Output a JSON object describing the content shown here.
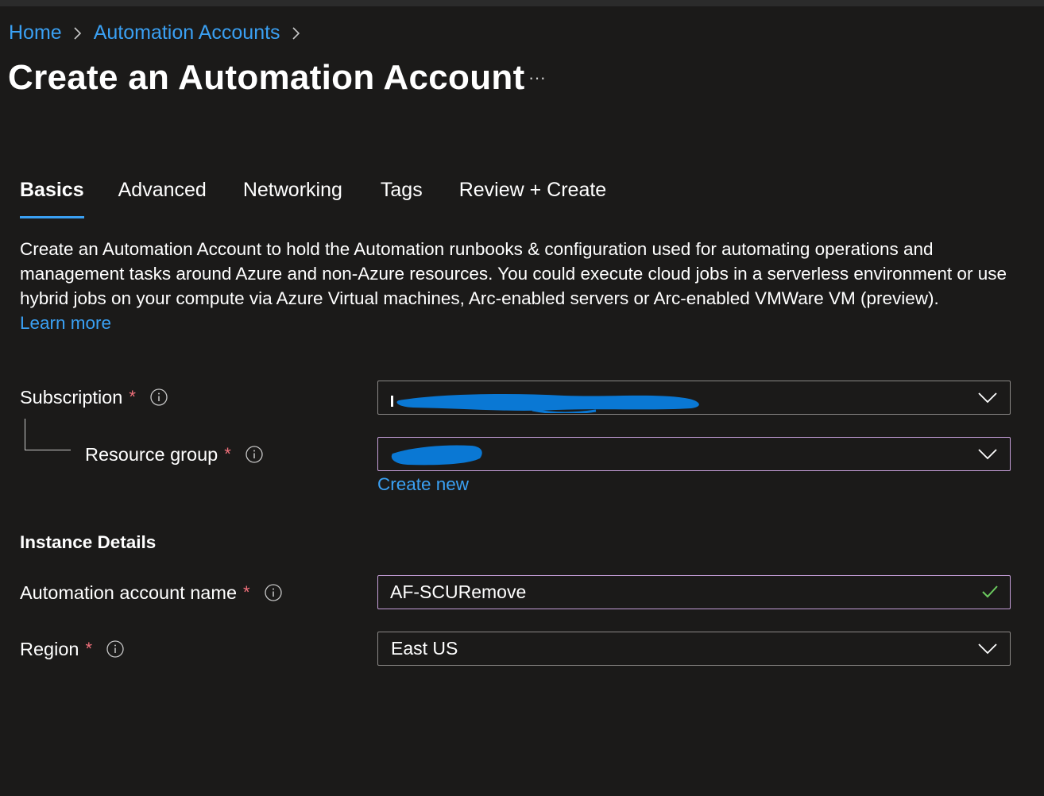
{
  "breadcrumb": {
    "items": [
      "Home",
      "Automation Accounts"
    ]
  },
  "page": {
    "title": "Create an Automation Account",
    "more_label": "···"
  },
  "tabs": [
    "Basics",
    "Advanced",
    "Networking",
    "Tags",
    "Review + Create"
  ],
  "active_tab": "Basics",
  "description": {
    "text": "Create an Automation Account to hold the Automation runbooks & configuration used for automating operations and management tasks around Azure and non-Azure resources. You could execute cloud jobs in a serverless environment or use hybrid jobs on your compute via Azure Virtual machines, Arc-enabled servers or Arc-enabled VMWare VM (preview).",
    "link": "Learn more"
  },
  "form": {
    "subscription": {
      "label": "Subscription",
      "required_mark": "*",
      "value_redacted": true
    },
    "resource_group": {
      "label": "Resource group",
      "required_mark": "*",
      "value_redacted": true,
      "create_new_link": "Create new"
    },
    "instance_details_heading": "Instance Details",
    "account_name": {
      "label": "Automation account name",
      "required_mark": "*",
      "value": "AF-SCURemove",
      "valid": true
    },
    "region": {
      "label": "Region",
      "required_mark": "*",
      "value": "East US"
    }
  },
  "icons": {
    "breadcrumb_separator": "chevron-right-icon",
    "info": "info-icon",
    "dropdown": "chevron-down-icon",
    "valid": "checkmark-icon"
  },
  "colors": {
    "background": "#1b1a19",
    "link": "#3aa0f3",
    "required": "#f1707b",
    "focus_border": "#c59fd8",
    "valid_check": "#6ccb5f",
    "redaction": "#0a78d4"
  }
}
